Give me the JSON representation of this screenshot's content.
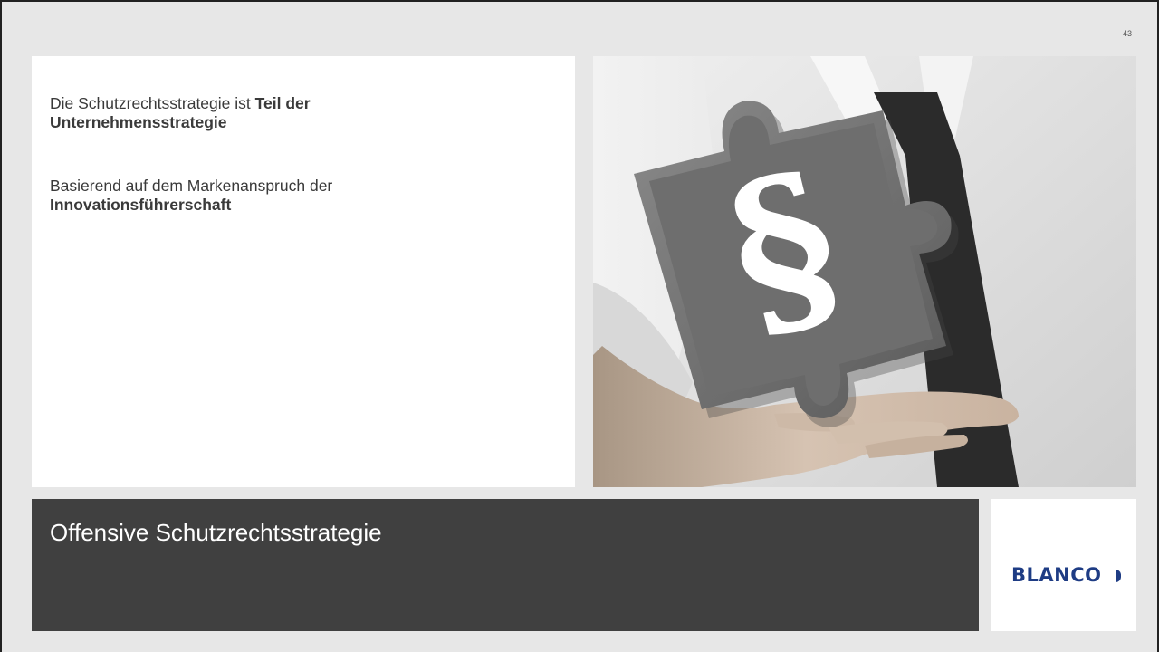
{
  "slide": {
    "page_number": "43",
    "content": {
      "p1_normal": "Die Schutzrechtsstrategie ist ",
      "p1_bold": "Teil der Unternehmensstrategie",
      "p2_normal": "Basierend auf dem Markenanspruch der ",
      "p2_bold": "Innovationsführerschaft"
    },
    "title": "Offensive Schutzrechtsstrategie",
    "logo": "BLANCO",
    "colors": {
      "background": "#e7e7e7",
      "title_bar": "#404040",
      "logo_blue": "#1e3c84"
    },
    "image": {
      "icon": "paragraph-puzzle-photo"
    }
  }
}
